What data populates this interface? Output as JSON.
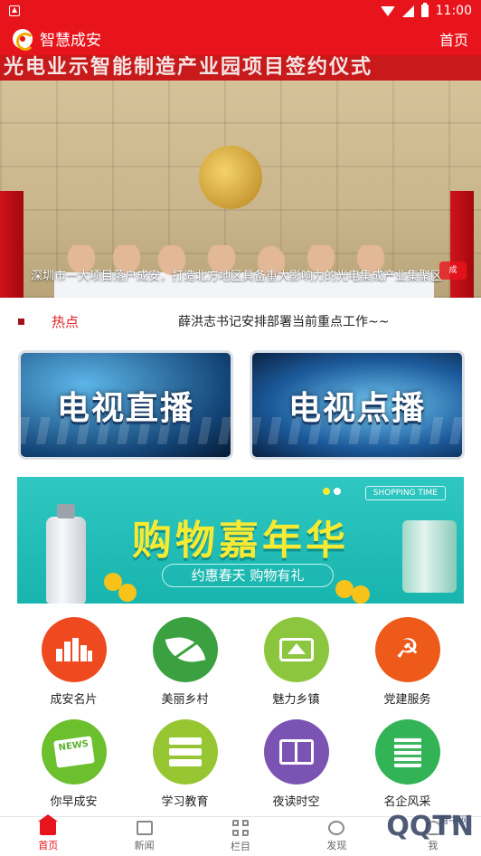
{
  "status_bar": {
    "time": "11:00"
  },
  "header": {
    "title": "智慧成安",
    "home_link": "首页"
  },
  "hero": {
    "banner_text": "光电业示智能制造产业园项目签约仪式",
    "caption": "深圳市一大项目落户成安，打造北方地区具备重大影响力的光电集成产业集聚区"
  },
  "hot": {
    "label": "热点",
    "text": "薛洪志书记安排部署当前重点工作~~"
  },
  "tv": {
    "live": "电视直播",
    "vod": "电视点播"
  },
  "shop": {
    "title": "购物嘉年华",
    "subtitle": "约惠春天 购物有礼",
    "tag": "SHOPPING TIME"
  },
  "grid": [
    {
      "label": "成安名片",
      "color": "#ef4a1f",
      "icon": "buildings-icon"
    },
    {
      "label": "美丽乡村",
      "color": "#3aa040",
      "icon": "leaf-icon"
    },
    {
      "label": "魅力乡镇",
      "color": "#8cc63e",
      "icon": "house-icon"
    },
    {
      "label": "党建服务",
      "color": "#ee5a1a",
      "icon": "party-emblem-icon"
    },
    {
      "label": "你早成安",
      "color": "#6cbf2d",
      "icon": "newspaper-icon"
    },
    {
      "label": "学习教育",
      "color": "#96c631",
      "icon": "books-icon"
    },
    {
      "label": "夜读时空",
      "color": "#7a53b3",
      "icon": "open-book-icon"
    },
    {
      "label": "名企风采",
      "color": "#32b356",
      "icon": "office-building-icon"
    }
  ],
  "bottom_nav": [
    {
      "label": "首页",
      "icon": "home-icon",
      "active": true
    },
    {
      "label": "新闻",
      "icon": "news-icon"
    },
    {
      "label": "栏目",
      "icon": "grid-icon"
    },
    {
      "label": "发现",
      "icon": "compass-icon"
    },
    {
      "label": "我",
      "icon": "user-icon"
    }
  ],
  "watermark": {
    "brand": "QQTN",
    "sub": "腾牛网"
  }
}
